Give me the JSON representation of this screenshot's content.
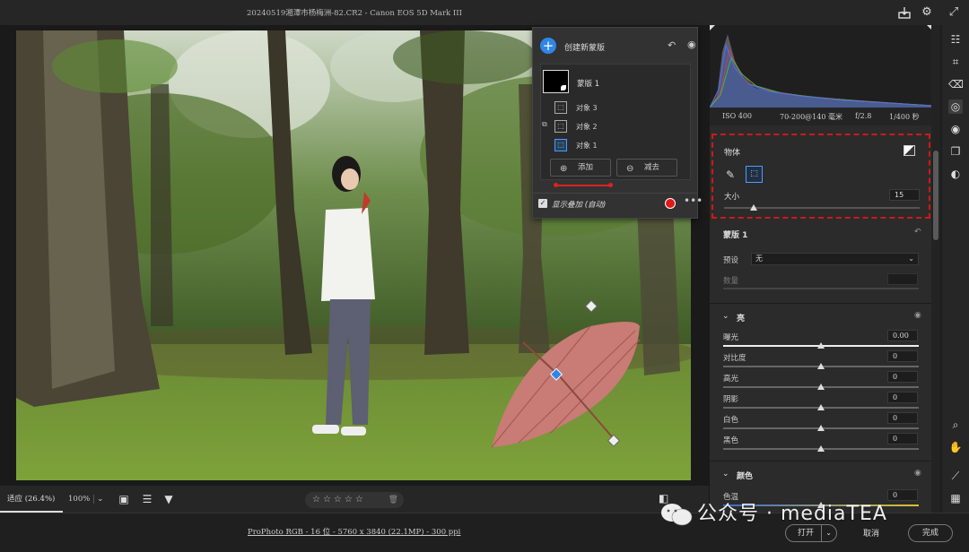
{
  "window": {
    "title": "20240519湘潭市杨梅洲-82.CR2 -  Canon EOS 5D Mark III",
    "icons": [
      "export-icon",
      "gear-icon",
      "expand-icon"
    ]
  },
  "mask_panel": {
    "create_label": "创建新蒙版",
    "mask_name": "蒙版 1",
    "objects": [
      "对象 3",
      "对象 2",
      "对象 1"
    ],
    "add_label": "添加",
    "subtract_label": "减去",
    "overlay_label": "显示叠加 (自动)",
    "overlay_checked": true,
    "overlay_color": "#e01818"
  },
  "histogram": {
    "iso": "ISO 400",
    "lens": "70-200@140 毫米",
    "aperture": "f/2.8",
    "shutter": "1/400 秒"
  },
  "object_section": {
    "title": "物体",
    "size_label": "大小",
    "size_value": "15",
    "size_fraction": 0.15
  },
  "mask_settings": {
    "name": "蒙版 1",
    "preset_label": "预设",
    "preset_value": "无",
    "amount_label": "数量"
  },
  "light": {
    "title": "亮",
    "rows": [
      {
        "label": "曝光",
        "value": "0.00"
      },
      {
        "label": "对比度",
        "value": "0"
      },
      {
        "label": "高光",
        "value": "0"
      },
      {
        "label": "阴影",
        "value": "0"
      },
      {
        "label": "白色",
        "value": "0"
      },
      {
        "label": "黑色",
        "value": "0"
      }
    ]
  },
  "color": {
    "title": "颜色",
    "rows": [
      {
        "label": "色温",
        "value": "0"
      }
    ]
  },
  "bottom_bar": {
    "fit_label": "适应 (26.4%)",
    "zoom_label": "100%",
    "rating_stars": "☆☆☆☆☆"
  },
  "footer": {
    "info": "ProPhoto RGB - 16 位 - 5760 x 3840 (22.1MP) - 300 ppi",
    "open_label": "打开",
    "cancel_label": "取消",
    "done_label": "完成"
  },
  "watermark": {
    "text": "公众号 · mediaTEA"
  },
  "colors": {
    "accent": "#2f86e6",
    "highlight_red": "#d01818"
  }
}
